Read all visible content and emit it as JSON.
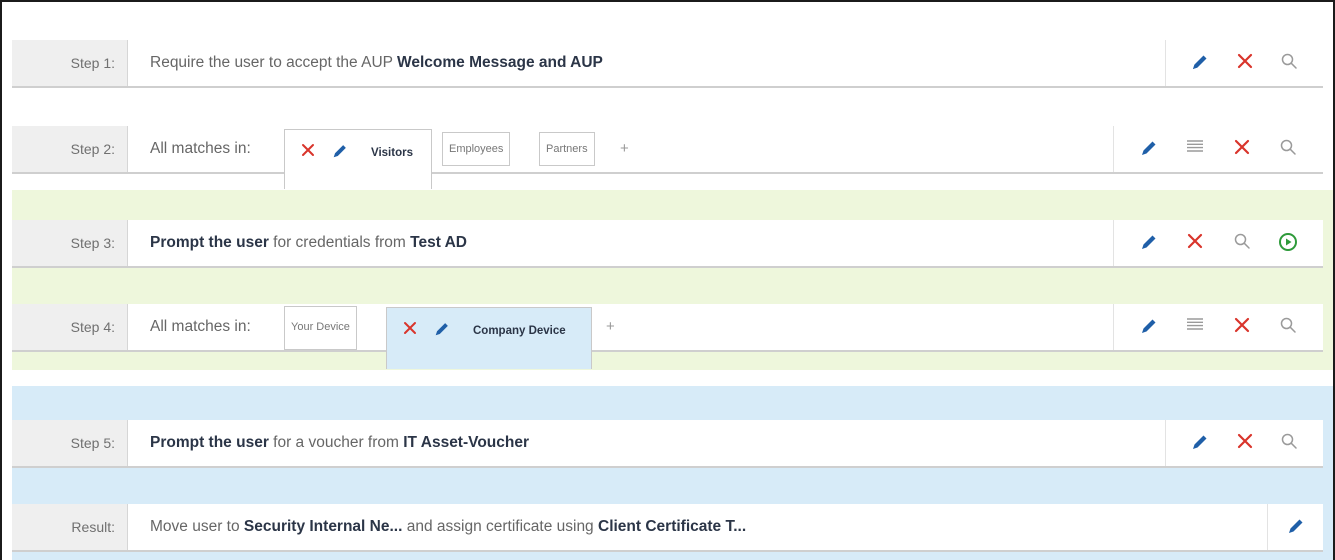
{
  "steps": [
    {
      "label": "Step 1:",
      "text_prefix": "Require the user to accept the AUP ",
      "text_bold": "Welcome Message and AUP"
    },
    {
      "label": "Step 2:",
      "matches_label": "All matches in:",
      "tabs": [
        "Visitors",
        "Employees",
        "Partners"
      ],
      "active_tab": "Visitors",
      "add_tab": "+"
    },
    {
      "label": "Step 3:",
      "bold_1": "Prompt the user",
      "middle": " for credentials from ",
      "bold_2": "Test AD"
    },
    {
      "label": "Step 4:",
      "matches_label": "All matches in:",
      "tabs": [
        "Your Device",
        "Company Device"
      ],
      "active_tab": "Company Device",
      "add_tab": "+"
    },
    {
      "label": "Step 5:",
      "bold_1": "Prompt the user",
      "middle": " for a voucher from ",
      "bold_2": "IT Asset-Voucher"
    }
  ],
  "result": {
    "label": "Result:",
    "text_1": "Move user to ",
    "bold_1": "Security Internal Ne...",
    "text_2": " and assign certificate using ",
    "bold_2": "Client Certificate T..."
  },
  "icons": {
    "edit": "pencil-icon",
    "delete": "close-x-icon",
    "inspect": "magnifier-icon",
    "reorder": "menu-lines-icon",
    "run": "play-circle-icon"
  },
  "colors": {
    "edit_blue": "#1f5fa8",
    "delete_red": "#d9342b",
    "run_green": "#2e9a3a",
    "band_green": "#eef7dc",
    "band_blue": "#d7ebf8"
  }
}
